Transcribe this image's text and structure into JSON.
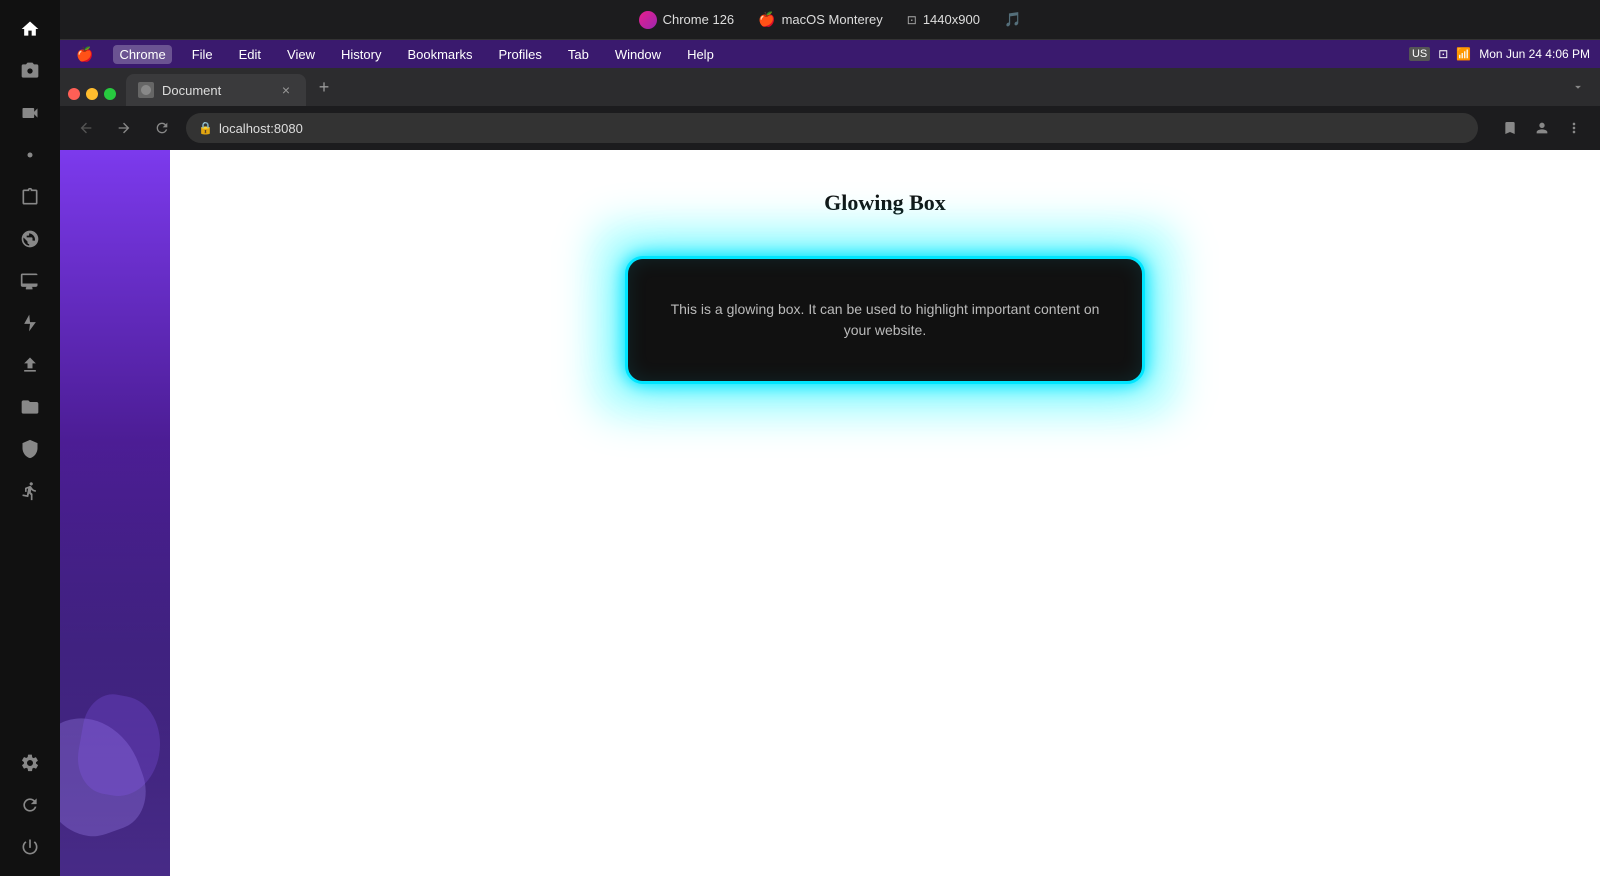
{
  "systemBar": {
    "browser": "Chrome 126",
    "os": "macOS Monterey",
    "resolution": "1440x900",
    "soundIcon": "🎵"
  },
  "menuBar": {
    "apple": "",
    "items": [
      "Chrome",
      "File",
      "Edit",
      "View",
      "History",
      "Bookmarks",
      "Profiles",
      "Tab",
      "Window",
      "Help"
    ],
    "rightTime": "Mon Jun 24  4:06 PM"
  },
  "tab": {
    "title": "Document",
    "closeLabel": "×",
    "newTabLabel": "+"
  },
  "addressBar": {
    "url": "localhost:8080"
  },
  "page": {
    "title": "Glowing Box",
    "glowText": "This is a glowing box. It can be used to highlight important content on your website."
  },
  "sidebar": {
    "icons": [
      "🏠",
      "📷",
      "🎬",
      "🕷",
      "📋",
      "🌐",
      "🖥",
      "⚡",
      "📤",
      "📁",
      "🛡",
      "🚶",
      "⚙",
      "🔄",
      "⏻"
    ]
  }
}
